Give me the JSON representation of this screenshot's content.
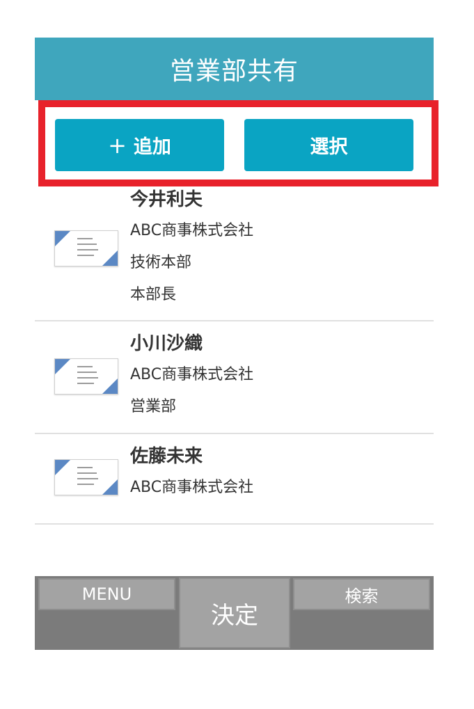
{
  "header": {
    "title": "営業部共有"
  },
  "actions": {
    "add_label": "追加",
    "add_icon": "+",
    "select_label": "選択",
    "highlight_color": "#e8222b"
  },
  "contacts": [
    {
      "name": "今井利夫",
      "company": "ABC商事株式会社",
      "department": "技術本部",
      "title": "本部長"
    },
    {
      "name": "小川沙織",
      "company": "ABC商事株式会社",
      "department": "営業部"
    },
    {
      "name": "佐藤未来",
      "company": "ABC商事株式会社"
    }
  ],
  "softkeys": {
    "left": "MENU",
    "center": "決定",
    "right": "検索"
  },
  "colors": {
    "header_bg": "#3fa6bd",
    "button_bg": "#0aa4c3",
    "softkey_bar_bg": "#7b7b7b"
  }
}
